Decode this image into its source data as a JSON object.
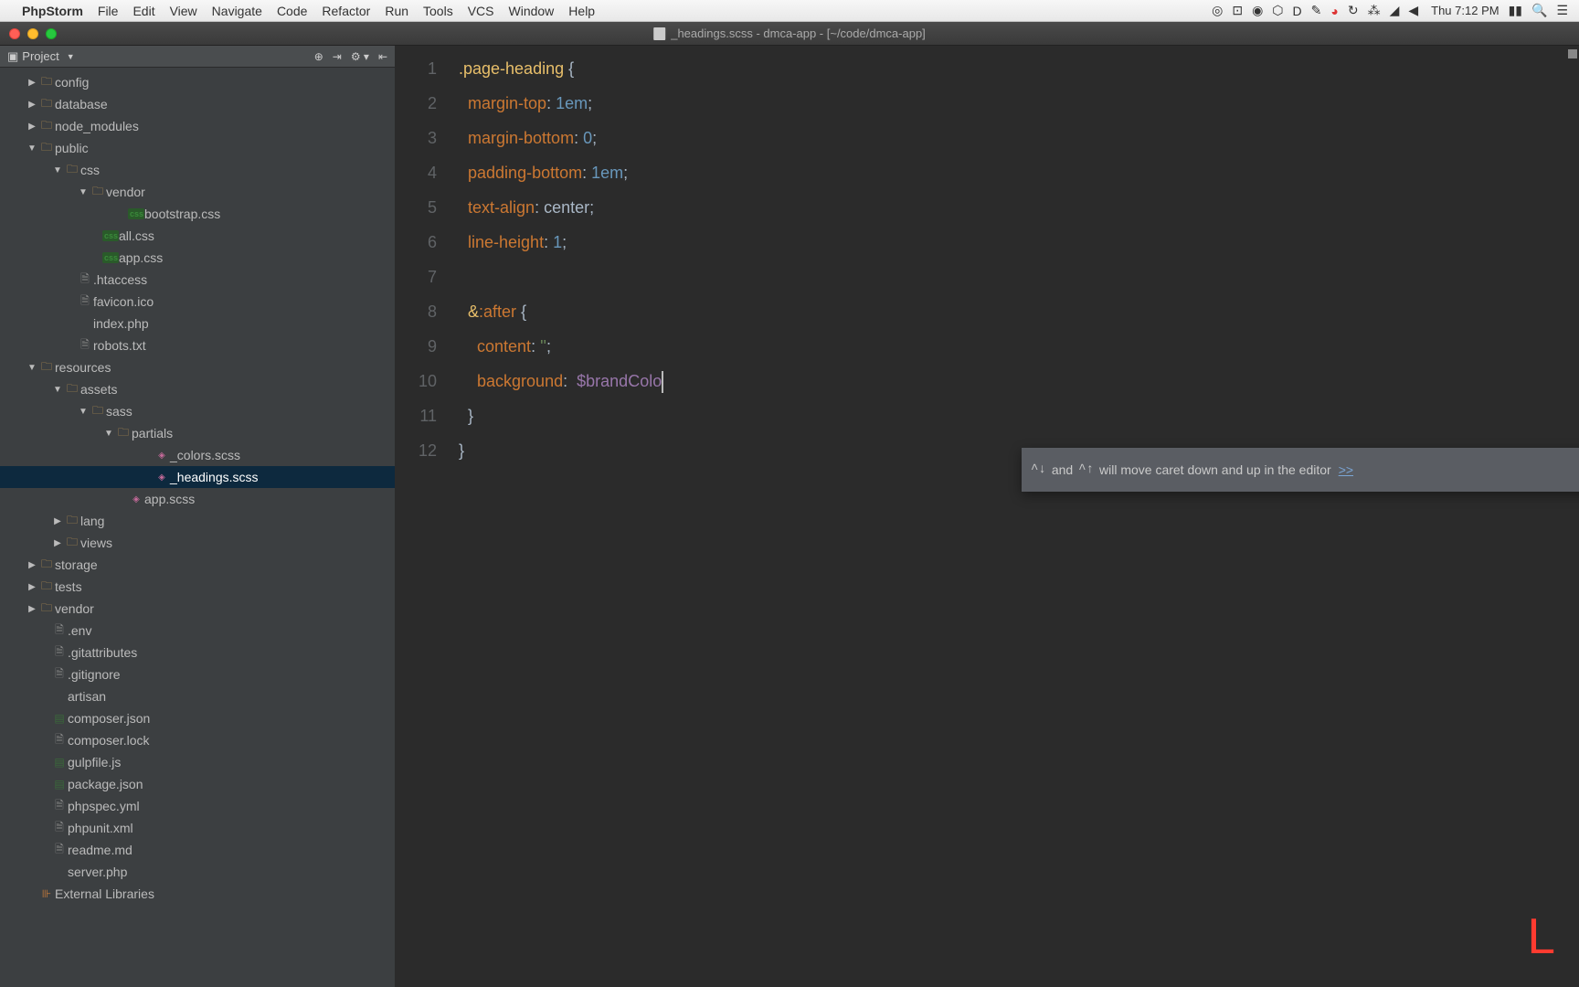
{
  "menubar": {
    "app_name": "PhpStorm",
    "items": [
      "File",
      "Edit",
      "View",
      "Navigate",
      "Code",
      "Refactor",
      "Run",
      "Tools",
      "VCS",
      "Window",
      "Help"
    ],
    "clock": "Thu 7:12 PM"
  },
  "window": {
    "title": "_headings.scss - dmca-app - [~/code/dmca-app]"
  },
  "sidebar": {
    "header": "Project",
    "tree": [
      {
        "label": "config",
        "indent": 28,
        "arrow": "▶",
        "icon": "folder"
      },
      {
        "label": "database",
        "indent": 28,
        "arrow": "▶",
        "icon": "folder"
      },
      {
        "label": "node_modules",
        "indent": 28,
        "arrow": "▶",
        "icon": "folder"
      },
      {
        "label": "public",
        "indent": 28,
        "arrow": "▼",
        "icon": "folder"
      },
      {
        "label": "css",
        "indent": 56,
        "arrow": "▼",
        "icon": "folder"
      },
      {
        "label": "vendor",
        "indent": 84,
        "arrow": "▼",
        "icon": "folder"
      },
      {
        "label": "bootstrap.css",
        "indent": 126,
        "arrow": "",
        "icon": "css"
      },
      {
        "label": "all.css",
        "indent": 98,
        "arrow": "",
        "icon": "css"
      },
      {
        "label": "app.css",
        "indent": 98,
        "arrow": "",
        "icon": "css"
      },
      {
        "label": ".htaccess",
        "indent": 70,
        "arrow": "",
        "icon": "file"
      },
      {
        "label": "favicon.ico",
        "indent": 70,
        "arrow": "",
        "icon": "file"
      },
      {
        "label": "index.php",
        "indent": 70,
        "arrow": "",
        "icon": "none"
      },
      {
        "label": "robots.txt",
        "indent": 70,
        "arrow": "",
        "icon": "file"
      },
      {
        "label": "resources",
        "indent": 28,
        "arrow": "▼",
        "icon": "folder"
      },
      {
        "label": "assets",
        "indent": 56,
        "arrow": "▼",
        "icon": "folder"
      },
      {
        "label": "sass",
        "indent": 84,
        "arrow": "▼",
        "icon": "folder"
      },
      {
        "label": "partials",
        "indent": 112,
        "arrow": "▼",
        "icon": "folder"
      },
      {
        "label": "_colors.scss",
        "indent": 154,
        "arrow": "",
        "icon": "scss"
      },
      {
        "label": "_headings.scss",
        "indent": 154,
        "arrow": "",
        "icon": "scss",
        "selected": true
      },
      {
        "label": "app.scss",
        "indent": 126,
        "arrow": "",
        "icon": "scss"
      },
      {
        "label": "lang",
        "indent": 56,
        "arrow": "▶",
        "icon": "folder"
      },
      {
        "label": "views",
        "indent": 56,
        "arrow": "▶",
        "icon": "folder"
      },
      {
        "label": "storage",
        "indent": 28,
        "arrow": "▶",
        "icon": "folder"
      },
      {
        "label": "tests",
        "indent": 28,
        "arrow": "▶",
        "icon": "folder"
      },
      {
        "label": "vendor",
        "indent": 28,
        "arrow": "▶",
        "icon": "folder"
      },
      {
        "label": ".env",
        "indent": 42,
        "arrow": "",
        "icon": "file"
      },
      {
        "label": ".gitattributes",
        "indent": 42,
        "arrow": "",
        "icon": "file"
      },
      {
        "label": ".gitignore",
        "indent": 42,
        "arrow": "",
        "icon": "file"
      },
      {
        "label": "artisan",
        "indent": 42,
        "arrow": "",
        "icon": "none"
      },
      {
        "label": "composer.json",
        "indent": 42,
        "arrow": "",
        "icon": "json"
      },
      {
        "label": "composer.lock",
        "indent": 42,
        "arrow": "",
        "icon": "file"
      },
      {
        "label": "gulpfile.js",
        "indent": 42,
        "arrow": "",
        "icon": "json"
      },
      {
        "label": "package.json",
        "indent": 42,
        "arrow": "",
        "icon": "json"
      },
      {
        "label": "phpspec.yml",
        "indent": 42,
        "arrow": "",
        "icon": "file"
      },
      {
        "label": "phpunit.xml",
        "indent": 42,
        "arrow": "",
        "icon": "file"
      },
      {
        "label": "readme.md",
        "indent": 42,
        "arrow": "",
        "icon": "file"
      },
      {
        "label": "server.php",
        "indent": 42,
        "arrow": "",
        "icon": "none"
      },
      {
        "label": "External Libraries",
        "indent": 28,
        "arrow": "",
        "icon": "lib"
      }
    ]
  },
  "editor": {
    "lines": [
      "1",
      "2",
      "3",
      "4",
      "5",
      "6",
      "7",
      "8",
      "9",
      "10",
      "11",
      "12"
    ],
    "l1_selector": ".page-heading",
    "l1_brace": " {",
    "l2_prop": "margin-top",
    "l2_val": "1em",
    "l3_prop": "margin-bottom",
    "l3_val": "0",
    "l4_prop": "padding-bottom",
    "l4_val": "1em",
    "l5_prop": "text-align",
    "l5_val": "center",
    "l6_prop": "line-height",
    "l6_val": "1",
    "l8_amp": "&",
    "l8_pseudo": ":after",
    "l8_brace": " {",
    "l9_prop": "content",
    "l9_val": "''",
    "l10_prop": "background",
    "l10_val": "$brandColo",
    "l11_brace": "}",
    "l12_brace": "}",
    "colon": ":",
    "semi": ";"
  },
  "tooltip": {
    "text_a": "^↓",
    "text_b": "and",
    "text_c": "^↑",
    "text_d": "will move caret down and up in the editor",
    "link": ">>"
  },
  "watermark": "L"
}
